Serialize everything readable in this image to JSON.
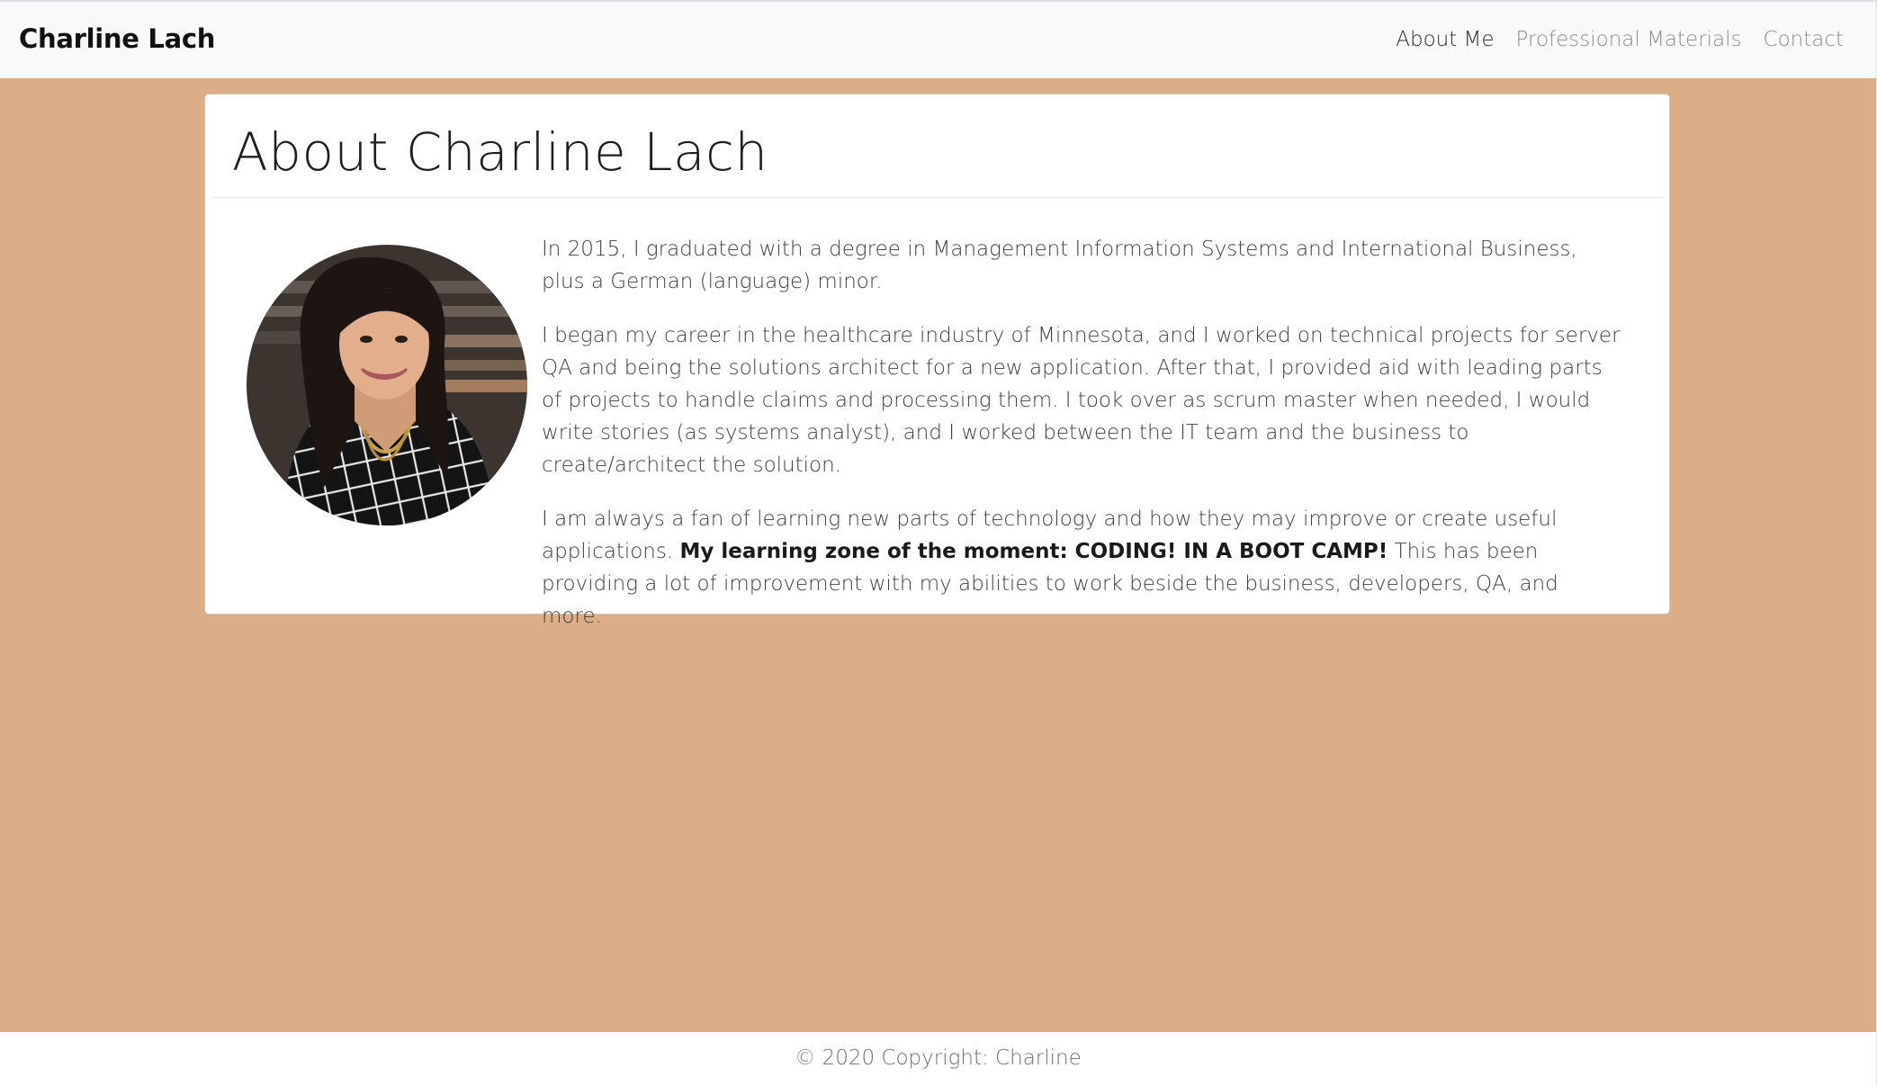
{
  "navbar": {
    "brand": "Charline Lach",
    "links": [
      {
        "label": "About Me",
        "active": true
      },
      {
        "label": "Professional Materials",
        "active": false
      },
      {
        "label": "Contact",
        "active": false
      }
    ]
  },
  "about": {
    "title": "About Charline Lach",
    "paragraph1": "In 2015, I graduated with a degree in Management Information Systems and International Business, plus a German (language) minor.",
    "paragraph2": "I began my career in the healthcare industry of Minnesota, and I worked on technical projects for server QA and being the solutions architect for a new application. After that, I provided aid with leading parts of projects to handle claims and processing them. I took over as scrum master when needed, I would write stories (as systems analyst), and I worked between the IT team and the business to create/architect the solution.",
    "paragraph3_start": "I am always a fan of learning new parts of technology and how they may improve or create useful applications. ",
    "paragraph3_bold": "My learning zone of the moment: CODING! IN A BOOT CAMP!",
    "paragraph3_end": " This has been providing a lot of improvement with my abilities to work beside the business, developers, QA, and more."
  },
  "footer": {
    "text": "© 2020 Copyright: Charline"
  },
  "colors": {
    "background": "#dbae87",
    "navbar": "#f8f9fa",
    "card": "#ffffff"
  }
}
